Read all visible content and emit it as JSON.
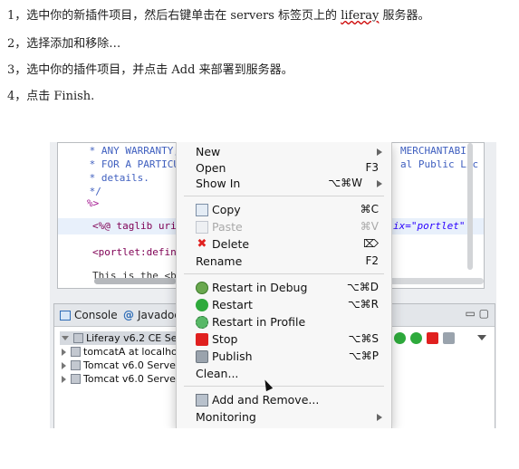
{
  "instructions": [
    {
      "num": "1，",
      "text_before": "选中你的新插件项目，然后右键单击在 servers 标签页上的 ",
      "link": "liferay",
      "text_after": " 服务器。"
    },
    {
      "num": "2，",
      "text": "选择添加和移除…"
    },
    {
      "num": "3，",
      "text": "选中你的插件项目，并点击 Add 来部署到服务器。"
    },
    {
      "num": "4，",
      "text": "点击 Finish."
    }
  ],
  "editor": {
    "lines": [
      {
        "left": " * ANY WARRANTY;",
        "right": "MERCHANTABIL"
      },
      {
        "left": " * FOR A PARTICU",
        "right": "al Public Lic"
      },
      {
        "left": " * details.",
        "right": ""
      },
      {
        "left": " */",
        "right": ""
      },
      {
        "left": "%>",
        "right": ""
      },
      {
        "left": "<%@ taglib uri=\"",
        "right": "ix=\"portlet\""
      },
      {
        "left": "<portlet:defineO",
        "right": ""
      },
      {
        "left": "This is the <b>E",
        "right": ""
      }
    ]
  },
  "console": {
    "tabs": [
      {
        "label": "Console",
        "icon": "console-icon"
      },
      {
        "label": "Javadoc",
        "icon": "at-icon"
      }
    ],
    "window_buttons": "▭ ▢",
    "servers": [
      {
        "label": "Liferay v6.2 CE Serve",
        "selected": true,
        "expanded": true
      },
      {
        "label": "tomcatA at localhost",
        "selected": false,
        "expanded": false
      },
      {
        "label": "Tomcat v6.0 Server a",
        "selected": false,
        "expanded": false
      },
      {
        "label": "Tomcat v6.0 Server a",
        "selected": false,
        "expanded": false
      }
    ]
  },
  "context_menu": {
    "items": [
      {
        "label": "New",
        "shortcut": "",
        "submenu": true,
        "icon": "",
        "disabled": false
      },
      {
        "label": "Open",
        "shortcut": "F3",
        "submenu": false,
        "icon": "",
        "disabled": false
      },
      {
        "label": "Show In",
        "shortcut": "⌥⌘W",
        "submenu": true,
        "icon": "",
        "disabled": false
      },
      {
        "label": "Copy",
        "shortcut": "⌘C",
        "submenu": false,
        "icon": "copy-icon",
        "disabled": false
      },
      {
        "label": "Paste",
        "shortcut": "⌘V",
        "submenu": false,
        "icon": "paste-icon",
        "disabled": true
      },
      {
        "label": "Delete",
        "shortcut": "⌦",
        "submenu": false,
        "icon": "delete-icon",
        "disabled": false
      },
      {
        "label": "Rename",
        "shortcut": "F2",
        "submenu": false,
        "icon": "",
        "disabled": false
      },
      {
        "label": "Restart in Debug",
        "shortcut": "⌥⌘D",
        "submenu": false,
        "icon": "debug-icon",
        "disabled": false
      },
      {
        "label": "Restart",
        "shortcut": "⌥⌘R",
        "submenu": false,
        "icon": "run-icon",
        "disabled": false
      },
      {
        "label": "Restart in Profile",
        "shortcut": "",
        "submenu": false,
        "icon": "profile-icon",
        "disabled": false
      },
      {
        "label": "Stop",
        "shortcut": "⌥⌘S",
        "submenu": false,
        "icon": "stop-icon",
        "disabled": false
      },
      {
        "label": "Publish",
        "shortcut": "⌥⌘P",
        "submenu": false,
        "icon": "publish-icon",
        "disabled": false
      },
      {
        "label": "Clean...",
        "shortcut": "",
        "submenu": false,
        "icon": "",
        "disabled": false
      },
      {
        "label": "Add and Remove...",
        "shortcut": "",
        "submenu": false,
        "icon": "add-remove-icon",
        "disabled": false
      },
      {
        "label": "Monitoring",
        "shortcut": "",
        "submenu": true,
        "icon": "",
        "disabled": false
      }
    ]
  }
}
